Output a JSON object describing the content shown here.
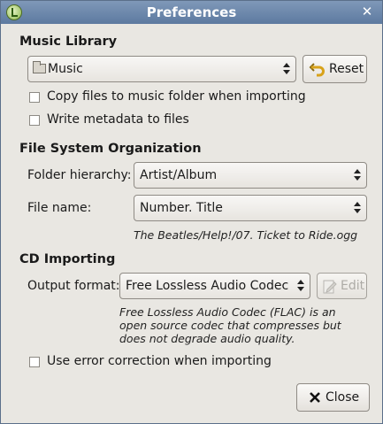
{
  "window": {
    "title": "Preferences",
    "close_glyph": "✕"
  },
  "music_library": {
    "heading": "Music Library",
    "heading_mnemonic_index": 6,
    "folder": "Music",
    "reset_label": "Reset",
    "copy_files_label": "Copy files to music folder when importing",
    "copy_files_checked": false,
    "write_metadata_label": "Write metadata to files",
    "write_metadata_checked": false
  },
  "file_system": {
    "heading": "File System Organization",
    "folder_hierarchy_label": "Folder hierarchy:",
    "folder_hierarchy_value": "Artist/Album",
    "file_name_label": "File name:",
    "file_name_value": "Number. Title",
    "example_path": "The Beatles/Help!/07. Ticket to Ride.ogg"
  },
  "cd_importing": {
    "heading": "CD Importing",
    "output_format_label": "Output format:",
    "output_format_value": "Free Lossless Audio Codec",
    "edit_label": "Edit",
    "format_description": "Free Lossless Audio Codec (FLAC) is an open source codec that compresses but does not degrade audio quality.",
    "error_correction_label": "Use error correction when importing",
    "error_correction_checked": false
  },
  "footer": {
    "close_label": "Close"
  },
  "icons": {
    "app": "app-icon",
    "folder": "folder-icon",
    "reset": "undo-arrow-icon",
    "edit": "edit-document-icon",
    "close": "close-x-icon"
  },
  "colors": {
    "titlebar": "#6a86aa",
    "window_bg": "#e9e7e2",
    "reset_arrow": "#d8a21a",
    "disabled_text": "#9a9893"
  }
}
